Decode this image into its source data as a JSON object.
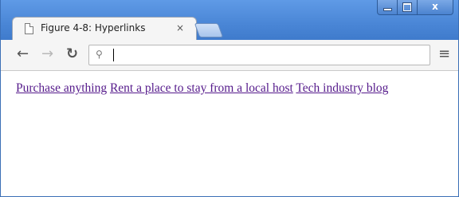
{
  "browser": {
    "tab_title": "Figure 4-8: Hyperlinks",
    "tab_close": "×",
    "window_close": "x",
    "icons": {
      "tab": "page-icon",
      "back": "arrow-left-icon",
      "forward": "arrow-right-icon",
      "reload": "reload-icon",
      "search": "search-icon",
      "menu": "hamburger-menu-icon"
    },
    "address": {
      "value": "",
      "placeholder": ""
    },
    "colors": {
      "titlebar": "#4a86d6",
      "link_visited": "#551a8b"
    }
  },
  "page": {
    "links": [
      {
        "label": "Purchase anything"
      },
      {
        "label": "Rent a place to stay from a local host"
      },
      {
        "label": "Tech industry blog"
      }
    ]
  }
}
